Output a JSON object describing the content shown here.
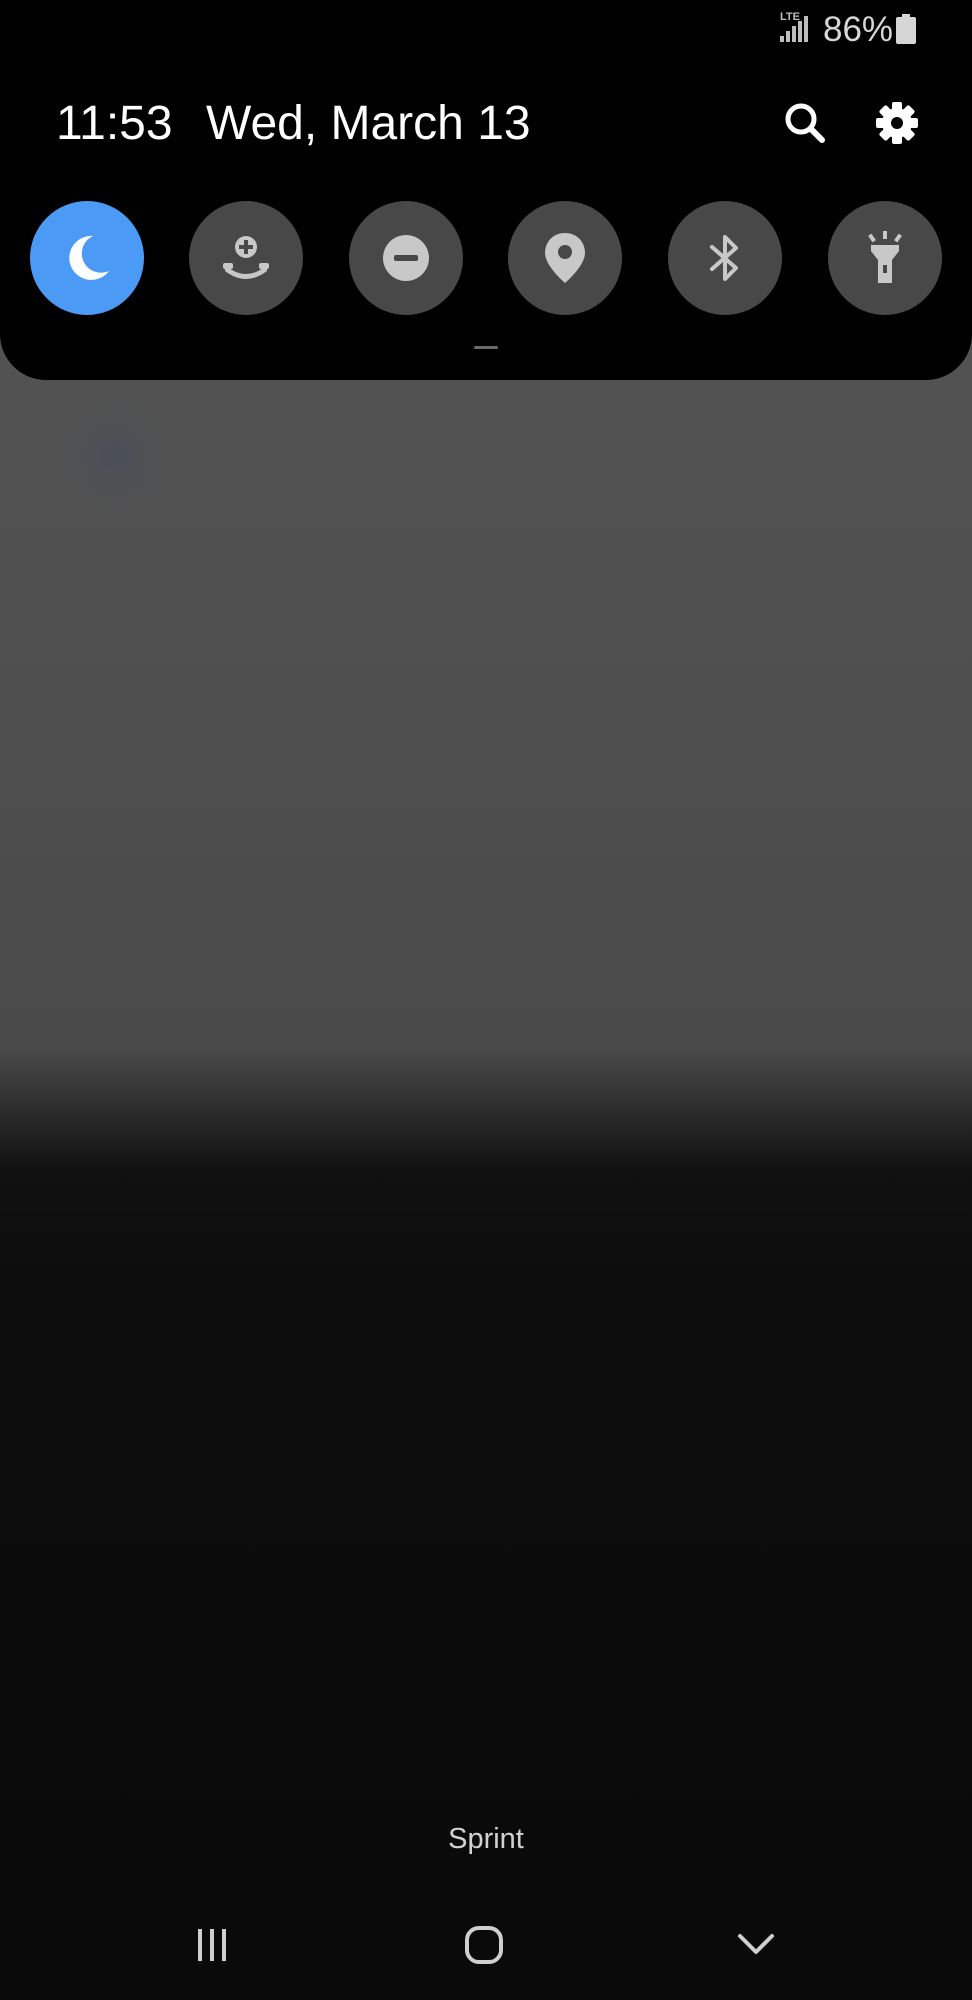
{
  "status_bar": {
    "network_label": "LTE",
    "signal_icon": "cellular-signal-icon",
    "battery_percent": "86%",
    "battery_icon": "battery-icon"
  },
  "quick_panel": {
    "time": "11:53",
    "date": "Wed, March 13",
    "search_icon": "search-icon",
    "settings_icon": "gear-icon",
    "tiles": [
      {
        "icon": "moon-icon",
        "active": true
      },
      {
        "icon": "mobile-hotspot-icon",
        "active": false
      },
      {
        "icon": "do-not-disturb-icon",
        "active": false
      },
      {
        "icon": "location-pin-icon",
        "active": false
      },
      {
        "icon": "bluetooth-icon",
        "active": false
      },
      {
        "icon": "flashlight-icon",
        "active": false
      }
    ]
  },
  "carrier": "Sprint",
  "navigation": {
    "recents_icon": "recents-icon",
    "home_icon": "home-icon",
    "back_icon": "chevron-down-icon"
  },
  "colors": {
    "active_tile": "#4b9bf6",
    "inactive_tile": "#484848",
    "panel_background": "#000000"
  }
}
